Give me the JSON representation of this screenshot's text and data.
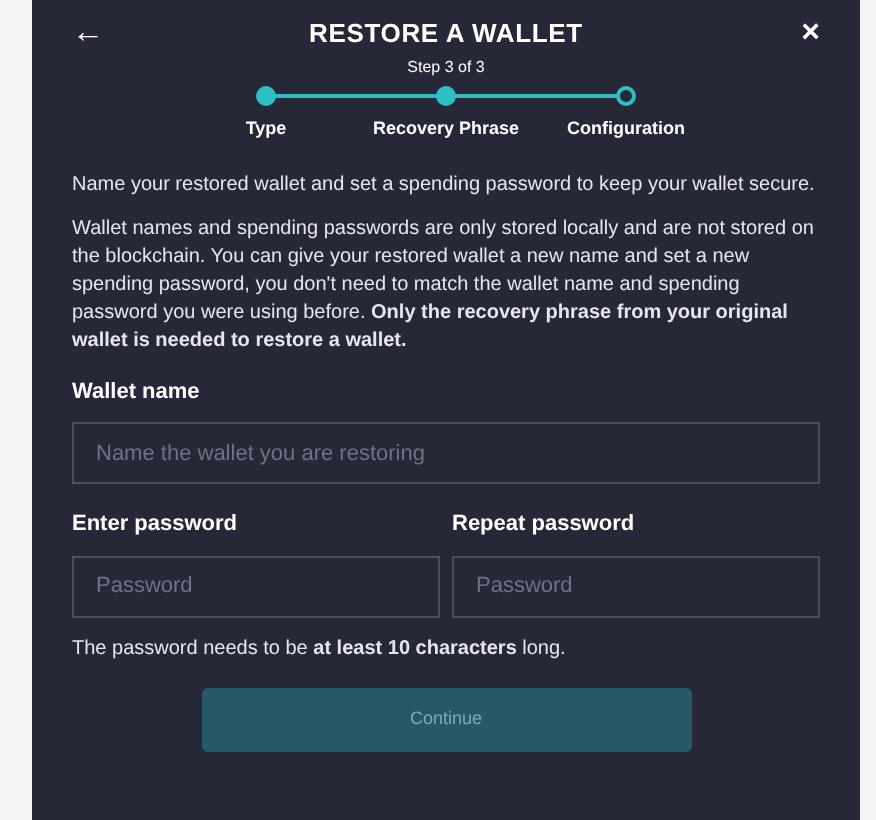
{
  "dialog": {
    "back": "←",
    "title": "RESTORE A WALLET",
    "subtitle": "Step 3 of 3",
    "close": "×"
  },
  "steps": [
    {
      "label": "Type",
      "done": true
    },
    {
      "label": "Recovery Phrase",
      "done": true
    },
    {
      "label": "Configuration",
      "done": false
    }
  ],
  "intro": "Name your restored wallet and set a spending password to keep your wallet secure.",
  "info": "Wallet names and spending passwords are only stored locally and are not stored on the blockchain. You can give your restored wallet a new name and set a new spending password, you don't need to match the wallet name and spending password you were using before. **Only the recovery phrase from your original wallet is needed to restore a wallet.**",
  "wallet_name": {
    "label": "Wallet name",
    "placeholder": "Name the wallet you are restoring"
  },
  "password": {
    "label": "Enter password",
    "placeholder": "Password"
  },
  "repeat_password": {
    "label": "Repeat password",
    "placeholder": "Password"
  },
  "hint": "The password needs to be **at least 10 characters** long.",
  "continue_button": {
    "label": "Continue",
    "disabled": true
  }
}
